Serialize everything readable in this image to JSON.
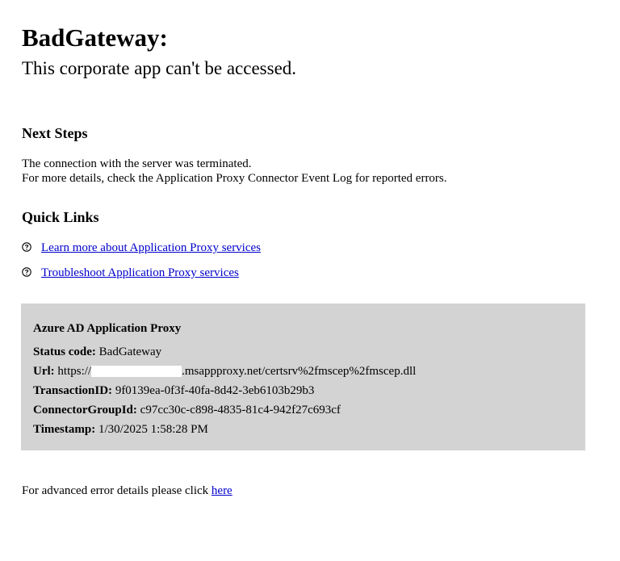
{
  "heading": {
    "title": "BadGateway:",
    "subtitle": "This corporate app can't be accessed."
  },
  "next_steps": {
    "heading": "Next Steps",
    "line1": "The connection with the server was terminated.",
    "line2": "For more details, check the Application Proxy Connector Event Log for reported errors."
  },
  "quick_links": {
    "heading": "Quick Links",
    "items": [
      {
        "label": "Learn more about Application Proxy services",
        "icon": "help-circle-icon"
      },
      {
        "label": "Troubleshoot Application Proxy services",
        "icon": "help-circle-icon"
      }
    ]
  },
  "details": {
    "title": "Azure AD Application Proxy",
    "status_label": "Status code:",
    "status_value": "BadGateway",
    "url_label": "Url:",
    "url_prefix": "https://",
    "url_suffix": ".msappproxy.net/certsrv%2fmscep%2fmscep.dll",
    "transaction_label": "TransactionID:",
    "transaction_value": "9f0139ea-0f3f-40fa-8d42-3eb6103b29b3",
    "connector_label": "ConnectorGroupId:",
    "connector_value": "c97cc30c-c898-4835-81c4-942f27c693cf",
    "timestamp_label": "Timestamp:",
    "timestamp_value": "1/30/2025 1:58:28 PM",
    "background_color": "#d3d3d3"
  },
  "footer": {
    "text": "For advanced error details please click ",
    "link_label": "here"
  },
  "colors": {
    "link": "#0000cc"
  }
}
